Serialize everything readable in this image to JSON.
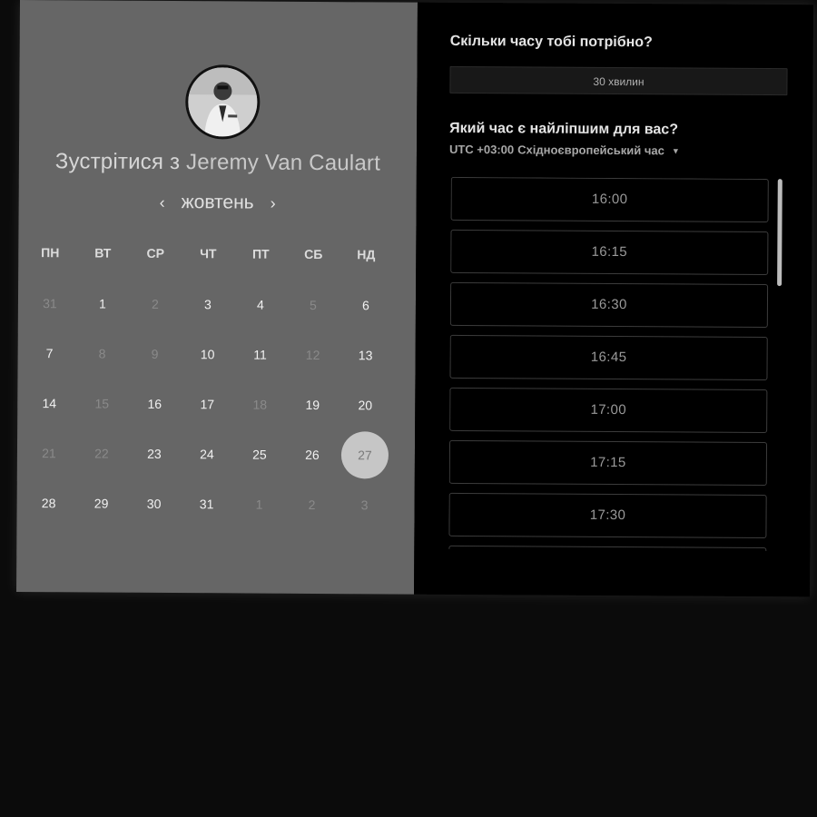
{
  "host": {
    "prefix": "Зустрітися з",
    "name": "Jeremy Van Caulart"
  },
  "calendar": {
    "month": "жовтень",
    "prev_icon": "chevron-left-icon",
    "next_icon": "chevron-right-icon",
    "weekdays": [
      "ПН",
      "ВТ",
      "СР",
      "ЧТ",
      "ПТ",
      "СБ",
      "НД"
    ],
    "weeks": [
      [
        {
          "d": "31",
          "m": true
        },
        {
          "d": "1",
          "m": false
        },
        {
          "d": "2",
          "m": true
        },
        {
          "d": "3",
          "m": false
        },
        {
          "d": "4",
          "m": false
        },
        {
          "d": "5",
          "m": true
        },
        {
          "d": "6",
          "m": false
        }
      ],
      [
        {
          "d": "7",
          "m": false
        },
        {
          "d": "8",
          "m": true
        },
        {
          "d": "9",
          "m": true
        },
        {
          "d": "10",
          "m": false
        },
        {
          "d": "11",
          "m": false
        },
        {
          "d": "12",
          "m": true
        },
        {
          "d": "13",
          "m": false
        }
      ],
      [
        {
          "d": "14",
          "m": false
        },
        {
          "d": "15",
          "m": true
        },
        {
          "d": "16",
          "m": false
        },
        {
          "d": "17",
          "m": false
        },
        {
          "d": "18",
          "m": true
        },
        {
          "d": "19",
          "m": false
        },
        {
          "d": "20",
          "m": false
        }
      ],
      [
        {
          "d": "21",
          "m": true
        },
        {
          "d": "22",
          "m": true
        },
        {
          "d": "23",
          "m": false
        },
        {
          "d": "24",
          "m": false
        },
        {
          "d": "25",
          "m": false
        },
        {
          "d": "26",
          "m": false
        },
        {
          "d": "27",
          "m": false,
          "sel": true
        }
      ],
      [
        {
          "d": "28",
          "m": false
        },
        {
          "d": "29",
          "m": false
        },
        {
          "d": "30",
          "m": false
        },
        {
          "d": "31",
          "m": false
        },
        {
          "d": "1",
          "m": true
        },
        {
          "d": "2",
          "m": true
        },
        {
          "d": "3",
          "m": true
        }
      ]
    ],
    "selected_day": "27"
  },
  "booking": {
    "duration_question": "Скільки часу тобі потрібно?",
    "duration_value": "30 хвилин",
    "time_question": "Який час є найліпшим для вас?",
    "timezone_offset": "UTC +03:00",
    "timezone_name": "Східноєвропейський час",
    "timezone_icon": "caret-down-icon",
    "slots": [
      "16:00",
      "16:15",
      "16:30",
      "16:45",
      "17:00",
      "17:15",
      "17:30",
      ""
    ]
  },
  "colors": {
    "left_panel": "#666666",
    "right_panel": "#000000",
    "selected_day_bg": "#c6c6c6"
  }
}
